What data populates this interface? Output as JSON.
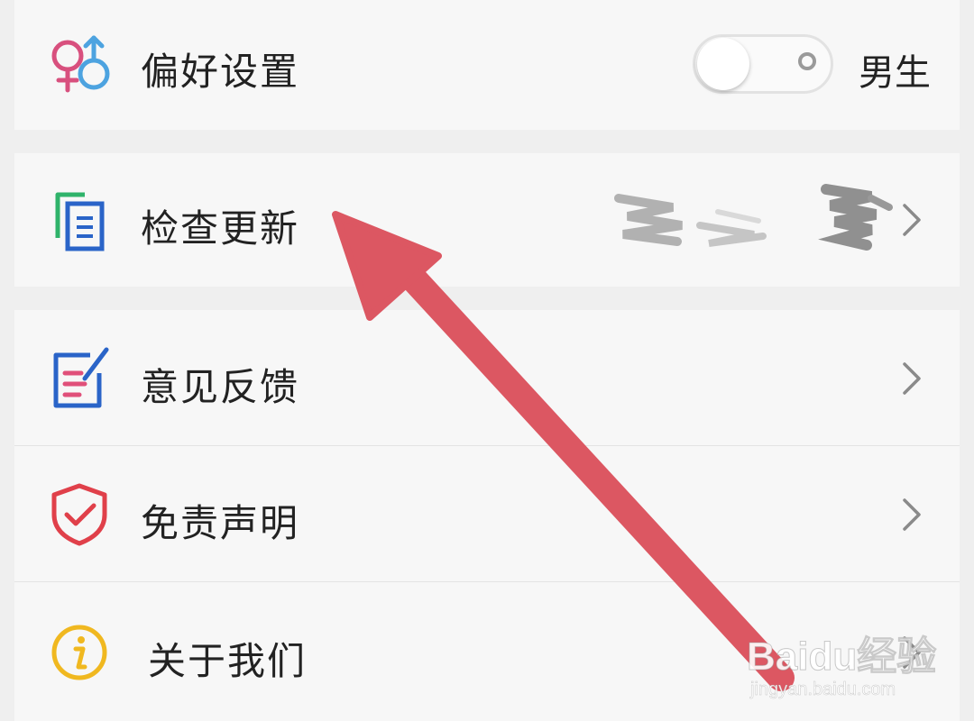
{
  "settings": {
    "preference": {
      "label": "偏好设置",
      "icon": "gender-icon",
      "toggle_on": false,
      "toggle_text": "男生"
    },
    "check_update": {
      "label": "检查更新",
      "icon": "document-copy-icon"
    },
    "feedback": {
      "label": "意见反馈",
      "icon": "edit-note-icon"
    },
    "disclaimer": {
      "label": "免责声明",
      "icon": "shield-check-icon"
    },
    "about": {
      "label": "关于我们",
      "icon": "info-icon"
    }
  },
  "watermark": {
    "brand": "Baidu经验",
    "url": "jingyan.baidu.com"
  },
  "colors": {
    "female_pink": "#d8507e",
    "male_blue": "#4da3e0",
    "accent_blue": "#2a64c8",
    "accent_green": "#2fb36a",
    "accent_pink": "#e0507a",
    "shield_red": "#e0404a",
    "info_yellow": "#f0b820",
    "arrow_red": "#dc5762"
  }
}
